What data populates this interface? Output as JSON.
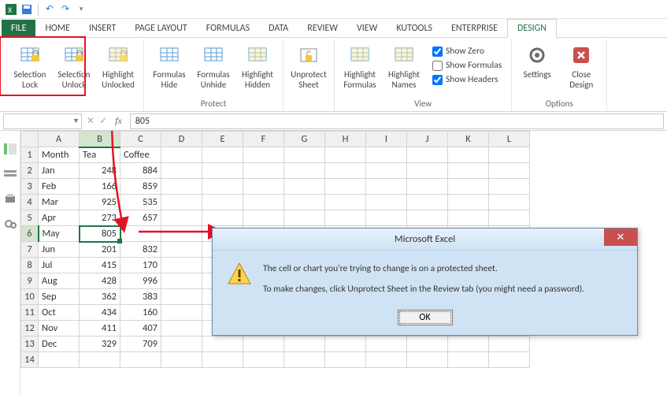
{
  "qat": {
    "icons": [
      "excel-icon",
      "save-icon",
      "undo-icon",
      "redo-icon",
      "refresh-icon"
    ]
  },
  "tabs": {
    "items": [
      "FILE",
      "HOME",
      "INSERT",
      "PAGE LAYOUT",
      "FORMULAS",
      "DATA",
      "REVIEW",
      "VIEW",
      "KUTOOLS",
      "ENTERPRISE",
      "DESIGN"
    ],
    "file_index": 0,
    "active_index": 10
  },
  "ribbon": {
    "groups": [
      {
        "label": "",
        "buttons": [
          {
            "name": "selection-lock-button",
            "l1": "Selection",
            "l2": "Lock",
            "icon": "lock-icon"
          },
          {
            "name": "selection-unlock-button",
            "l1": "Selection",
            "l2": "Unlock",
            "icon": "unlock-icon"
          },
          {
            "name": "highlight-unlocked-button",
            "l1": "Highlight",
            "l2": "Unlocked",
            "icon": "highlight-unlocked-icon"
          }
        ]
      },
      {
        "label": "Protect",
        "buttons": [
          {
            "name": "formulas-hide-button",
            "l1": "Formulas",
            "l2": "Hide",
            "icon": "formulas-hide-icon"
          },
          {
            "name": "formulas-unhide-button",
            "l1": "Formulas",
            "l2": "Unhide",
            "icon": "formulas-unhide-icon"
          },
          {
            "name": "highlight-hidden-button",
            "l1": "Highlight",
            "l2": "Hidden",
            "icon": "highlight-hidden-icon"
          }
        ]
      },
      {
        "label": "",
        "buttons": [
          {
            "name": "unprotect-sheet-button",
            "l1": "Unprotect",
            "l2": "Sheet",
            "icon": "unprotect-icon"
          }
        ]
      },
      {
        "label": "View",
        "buttons": [
          {
            "name": "highlight-formulas-button",
            "l1": "Highlight",
            "l2": "Formulas",
            "icon": "highlight-formulas-icon"
          },
          {
            "name": "highlight-names-button",
            "l1": "Highlight",
            "l2": "Names",
            "icon": "highlight-names-icon"
          }
        ],
        "checks": [
          {
            "name": "show-zero-check",
            "label": "Show Zero",
            "checked": true
          },
          {
            "name": "show-formulas-check",
            "label": "Show Formulas",
            "checked": false
          },
          {
            "name": "show-headers-check",
            "label": "Show Headers",
            "checked": true
          }
        ]
      },
      {
        "label": "Options",
        "buttons": [
          {
            "name": "settings-button",
            "l1": "Settings",
            "l2": "",
            "icon": "gear-icon"
          },
          {
            "name": "close-design-button",
            "l1": "Close",
            "l2": "Design",
            "icon": "close-icon"
          }
        ]
      }
    ]
  },
  "formula_bar": {
    "namebox": "",
    "fx_label": "fx",
    "value": "805"
  },
  "grid": {
    "columns": [
      "A",
      "B",
      "C",
      "D",
      "E",
      "F",
      "G",
      "H",
      "I",
      "J",
      "K",
      "L"
    ],
    "selected_col": "B",
    "selected_row": 6,
    "rows": [
      {
        "r": 1,
        "A": "Month",
        "B": "Tea",
        "C": "Coffee"
      },
      {
        "r": 2,
        "A": "Jan",
        "B": 248,
        "C": 884
      },
      {
        "r": 3,
        "A": "Feb",
        "B": 166,
        "C": 859
      },
      {
        "r": 4,
        "A": "Mar",
        "B": 925,
        "C": 535
      },
      {
        "r": 5,
        "A": "Apr",
        "B": 273,
        "C": 657
      },
      {
        "r": 6,
        "A": "May",
        "B": 805,
        "C": ""
      },
      {
        "r": 7,
        "A": "Jun",
        "B": 201,
        "C": 832
      },
      {
        "r": 8,
        "A": "Jul",
        "B": 415,
        "C": 170
      },
      {
        "r": 9,
        "A": "Aug",
        "B": 428,
        "C": 996
      },
      {
        "r": 10,
        "A": "Sep",
        "B": 362,
        "C": 383
      },
      {
        "r": 11,
        "A": "Oct",
        "B": 434,
        "C": 160
      },
      {
        "r": 12,
        "A": "Nov",
        "B": 411,
        "C": 407
      },
      {
        "r": 13,
        "A": "Dec",
        "B": 329,
        "C": 709
      },
      {
        "r": 14,
        "A": "",
        "B": "",
        "C": ""
      }
    ]
  },
  "dialog": {
    "title": "Microsoft Excel",
    "line1": "The cell or chart you're trying to change is on a protected sheet.",
    "line2": "To make changes, click Unprotect Sheet in the Review tab (you might need a password).",
    "ok": "OK"
  },
  "colors": {
    "accent": "#217346",
    "red": "#e81123"
  }
}
